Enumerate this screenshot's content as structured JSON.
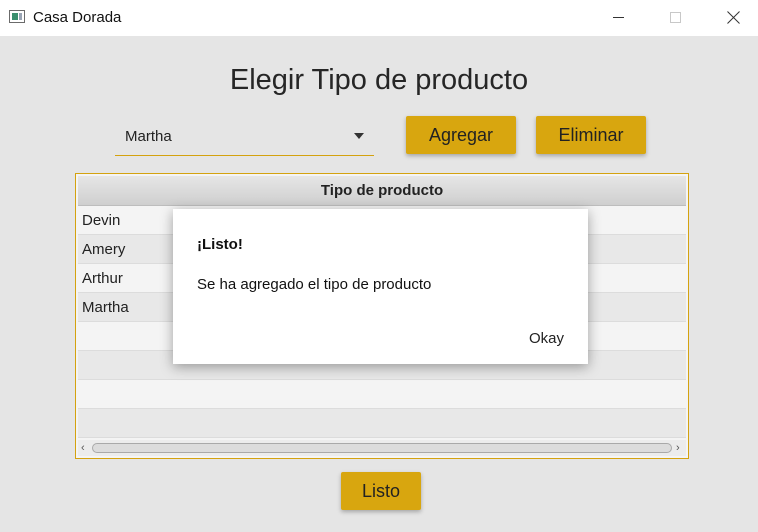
{
  "window": {
    "title": "Casa Dorada",
    "icons": {
      "app": "app-window-icon",
      "minimize": "minimize-icon",
      "maximize": "maximize-icon",
      "close": "close-icon"
    }
  },
  "page": {
    "title": "Elegir Tipo de producto"
  },
  "combo": {
    "value": "Martha",
    "arrow_icon": "chevron-down-icon"
  },
  "buttons": {
    "agregar": "Agregar",
    "eliminar": "Eliminar",
    "listo": "Listo"
  },
  "table": {
    "header": "Tipo de producto",
    "rows": [
      "Devin",
      "Amery",
      "Arthur",
      "Martha",
      "",
      "",
      "",
      ""
    ],
    "scroll_left": "‹",
    "scroll_right": "›"
  },
  "dialog": {
    "title": "¡Listo!",
    "message": "Se ha agregado el tipo de producto",
    "ok": "Okay"
  },
  "colors": {
    "accent": "#d8a60f",
    "background": "#e5e5e5"
  }
}
